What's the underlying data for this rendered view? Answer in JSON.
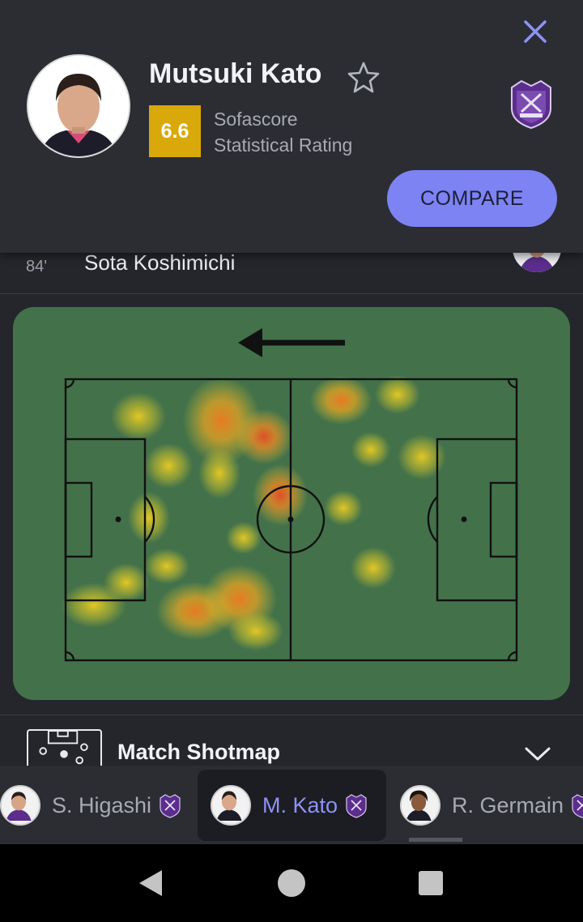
{
  "header": {
    "player_name": "Mutsuki Kato",
    "rating": "6.6",
    "rating_label_line1": "Sofascore",
    "rating_label_line2": "Statistical Rating",
    "compare_label": "COMPARE",
    "icons": {
      "close": "close-icon",
      "favorite": "star-outline-icon",
      "team": "team-crest-icon"
    },
    "rating_color": "#d9a90b",
    "accent_color": "#7d83f2"
  },
  "substitution": {
    "minute": "84'",
    "player_name": "Sota Koshimichi"
  },
  "heatmap": {
    "attack_direction": "left",
    "pitch_color": "#43724a"
  },
  "shotmap": {
    "title": "Match Shotmap",
    "expanded": false
  },
  "player_tabs": [
    {
      "name": "S. Higashi",
      "active": false
    },
    {
      "name": "M. Kato",
      "active": true
    },
    {
      "name": "R. Germain",
      "active": false
    }
  ],
  "system_nav": {
    "buttons": [
      "back-icon",
      "home-icon",
      "recents-icon"
    ]
  }
}
